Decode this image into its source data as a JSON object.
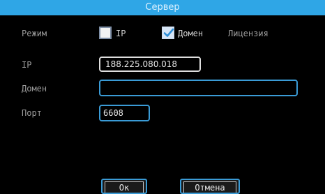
{
  "dialog": {
    "title": "Сервер"
  },
  "labels": {
    "mode": "Режим",
    "ip": "IP",
    "domain": "Домен",
    "port": "Порт"
  },
  "mode_options": {
    "ip_label": "IP",
    "ip_checked": false,
    "domain_label": "Домен",
    "domain_checked": true,
    "license_label": "Лицензия"
  },
  "fields": {
    "ip_value": "188.225.080.018",
    "domain_value": "",
    "port_value": "6608"
  },
  "buttons": {
    "ok_label": "Ок",
    "cancel_label": "Отмена"
  },
  "colors": {
    "title_bar": "#2fa6e6",
    "field_border_active": "#3a9bd6",
    "background": "#000000"
  }
}
